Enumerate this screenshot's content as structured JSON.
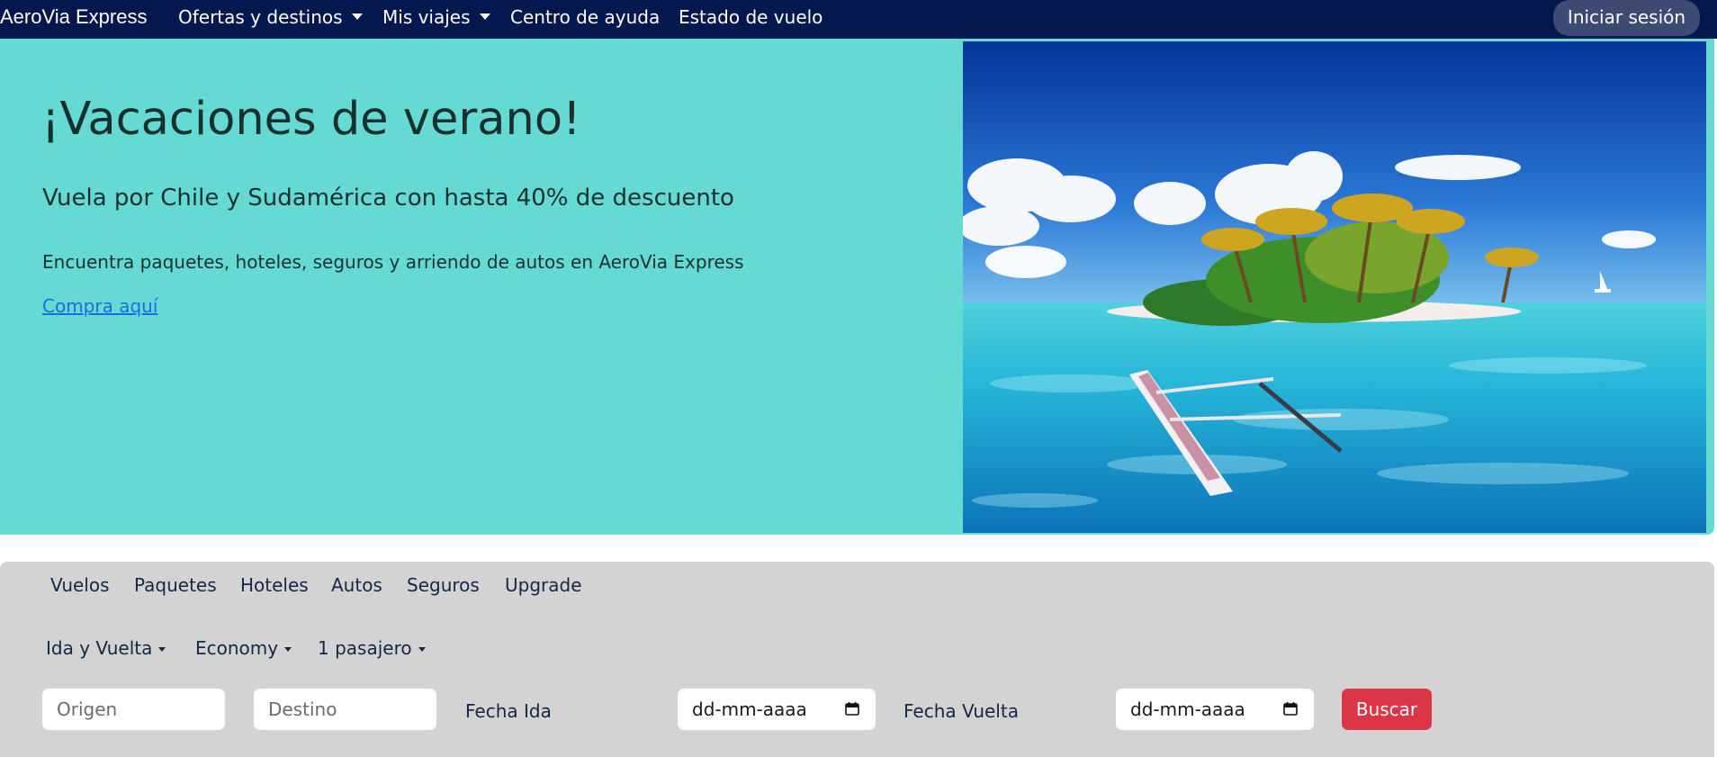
{
  "navbar": {
    "brand": "AeroVia Express",
    "items": [
      {
        "label": "Ofertas y destinos",
        "dropdown": true
      },
      {
        "label": "Mis viajes",
        "dropdown": true
      },
      {
        "label": "Centro de ayuda",
        "dropdown": false
      },
      {
        "label": "Estado de vuelo",
        "dropdown": false
      }
    ],
    "login_label": "Iniciar sesión",
    "background_color": "#05174f"
  },
  "hero": {
    "title": "¡Vacaciones de verano!",
    "subtitle": "Vuela por Chile y Sudamérica con hasta 40% de descuento",
    "text": "Encuentra paquetes, hoteles, seguros y arriendo de autos en AeroVia Express",
    "link_label": "Compra aquí",
    "background_color": "#65dad4"
  },
  "search": {
    "tabs": [
      "Vuelos",
      "Paquetes",
      "Hoteles",
      "Autos",
      "Seguros",
      "Upgrade"
    ],
    "options": {
      "trip_type": "Ida y Vuelta",
      "cabin": "Economy",
      "passengers": "1 pasajero"
    },
    "origin_placeholder": "Origen",
    "destination_placeholder": "Destino",
    "depart_label": "Fecha Ida",
    "depart_value": "dd-mm-aaaa",
    "return_label": "Fecha Vuelta",
    "return_value": "dd-mm-aaaa",
    "button_label": "Buscar",
    "button_color": "#dc3545"
  }
}
